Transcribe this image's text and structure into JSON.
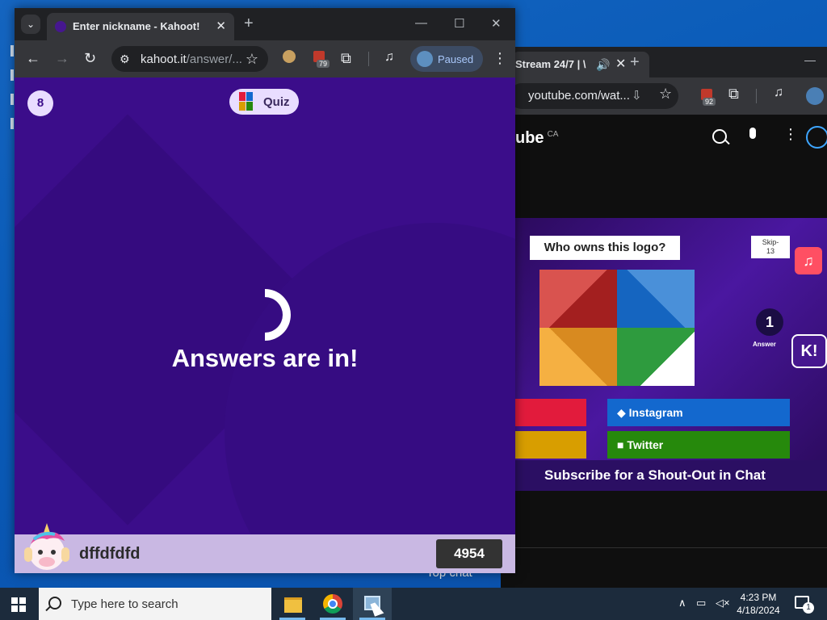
{
  "kahoot_window": {
    "tab_title": "Enter nickname - Kahoot!",
    "url_main": "kahoot.it",
    "url_rest": "/answer/...",
    "extension_badge": "79",
    "profile_status": "Paused",
    "player_count": "8",
    "game_mode": "Quiz",
    "status_message": "Answers are in!",
    "nickname": "dffdfdfd",
    "score": "4954",
    "accent_color": "#3b0d8a"
  },
  "youtube_window": {
    "tab_title": "Stream 24/7 | \\",
    "url": "youtube.com/wat...",
    "extension_badge": "92",
    "logo_text": "ube",
    "country_code": "CA",
    "video": {
      "question": "Who owns this logo?",
      "skip_label": "Skip-",
      "skip_count": "13",
      "answer_count": "1",
      "answer_label": "Answer",
      "answers": [
        "Instagram",
        "Twitter"
      ],
      "banner": "Subscribe for a Shout-Out in Chat"
    },
    "chat_label": "Top chat"
  },
  "taskbar": {
    "search_placeholder": "Type here to search",
    "time": "4:23 PM",
    "date": "4/18/2024",
    "notification_count": "1"
  }
}
